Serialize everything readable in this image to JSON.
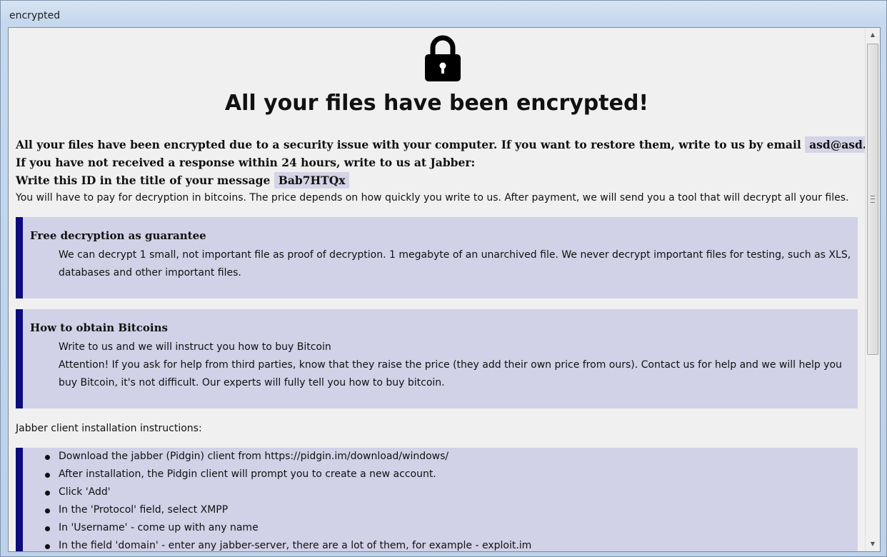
{
  "window": {
    "title": "encrypted"
  },
  "main": {
    "heading": "All your files have been encrypted!",
    "intro": {
      "line1_text": "All your files have been encrypted due to a security issue with your computer. If you want to restore them, write to us by email",
      "email": "asd@asd.com",
      "line2_text": "If you have not received a response within 24 hours, write to us at Jabber:",
      "line3_text": "Write this ID in the title of your message",
      "id": "Bab7HTQx",
      "line4_text": "You will have to pay for decryption in bitcoins. The price depends on how quickly you write to us. After payment, we will send you a tool that will decrypt all your files."
    },
    "guarantee": {
      "title": "Free decryption as guarantee",
      "text": "We can decrypt 1 small, not important file as proof of decryption. 1 megabyte of an unarchived file. We never decrypt important files for testing, such as XLS, databases and other important files."
    },
    "bitcoins": {
      "title": "How to obtain Bitcoins",
      "line1": "Write to us and we will instruct you how to buy Bitcoin",
      "line2": "Attention! If you ask for help from third parties, know that they raise the price (they add their own price from ours). Contact us for help and we will help you buy Bitcoin, it's not difficult. Our experts will fully tell you how to buy bitcoin."
    },
    "jabber_heading": "Jabber client installation instructions:",
    "jabber_steps": [
      "Download the jabber (Pidgin) client from https://pidgin.im/download/windows/",
      "After installation, the Pidgin client will prompt you to create a new account.",
      "Click 'Add'",
      "In the 'Protocol' field, select XMPP",
      "In 'Username' - come up with any name",
      "In the field 'domain' - enter any jabber-server, there are a lot of them, for example - exploit.im"
    ]
  },
  "icons": {
    "lock": "lock-icon",
    "scroll_up": "scroll-up-arrow-icon",
    "scroll_down": "scroll-down-arrow-icon"
  }
}
